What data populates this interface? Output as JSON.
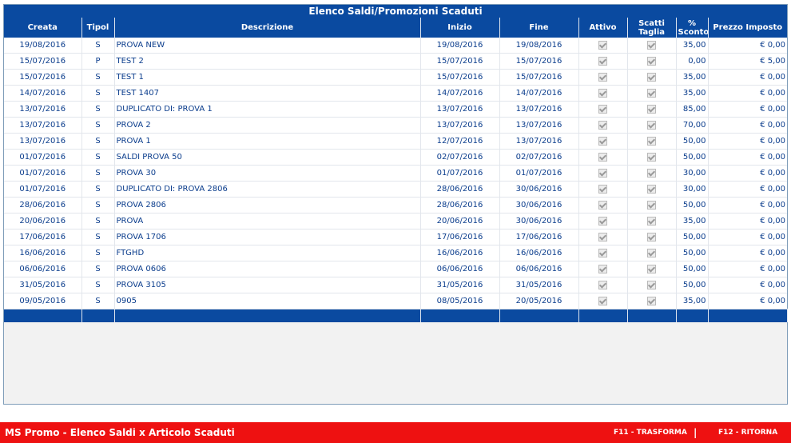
{
  "panel": {
    "title": "Elenco Saldi/Promozioni Scaduti"
  },
  "table": {
    "headers": [
      "Creata",
      "Tipol",
      "Descrizione",
      "Inizio",
      "Fine",
      "Attivo",
      "Scatti Taglia",
      "% Sconto",
      "Prezzo Imposto"
    ],
    "rows": [
      {
        "creata": "19/08/2016",
        "tipol": "S",
        "descrizione": "PROVA NEW",
        "inizio": "19/08/2016",
        "fine": "19/08/2016",
        "attivo": true,
        "scatti": true,
        "sconto": "35,00",
        "prezzo": "€ 0,00"
      },
      {
        "creata": "15/07/2016",
        "tipol": "P",
        "descrizione": "TEST 2",
        "inizio": "15/07/2016",
        "fine": "15/07/2016",
        "attivo": true,
        "scatti": true,
        "sconto": "0,00",
        "prezzo": "€ 5,00"
      },
      {
        "creata": "15/07/2016",
        "tipol": "S",
        "descrizione": "TEST 1",
        "inizio": "15/07/2016",
        "fine": "15/07/2016",
        "attivo": true,
        "scatti": true,
        "sconto": "35,00",
        "prezzo": "€ 0,00"
      },
      {
        "creata": "14/07/2016",
        "tipol": "S",
        "descrizione": "TEST 1407",
        "inizio": "14/07/2016",
        "fine": "14/07/2016",
        "attivo": true,
        "scatti": true,
        "sconto": "35,00",
        "prezzo": "€ 0,00"
      },
      {
        "creata": "13/07/2016",
        "tipol": "S",
        "descrizione": "DUPLICATO DI: PROVA 1",
        "inizio": "13/07/2016",
        "fine": "13/07/2016",
        "attivo": true,
        "scatti": true,
        "sconto": "85,00",
        "prezzo": "€ 0,00"
      },
      {
        "creata": "13/07/2016",
        "tipol": "S",
        "descrizione": "PROVA 2",
        "inizio": "13/07/2016",
        "fine": "13/07/2016",
        "attivo": true,
        "scatti": true,
        "sconto": "70,00",
        "prezzo": "€ 0,00"
      },
      {
        "creata": "13/07/2016",
        "tipol": "S",
        "descrizione": "PROVA 1",
        "inizio": "12/07/2016",
        "fine": "13/07/2016",
        "attivo": true,
        "scatti": true,
        "sconto": "50,00",
        "prezzo": "€ 0,00"
      },
      {
        "creata": "01/07/2016",
        "tipol": "S",
        "descrizione": "SALDI PROVA 50",
        "inizio": "02/07/2016",
        "fine": "02/07/2016",
        "attivo": true,
        "scatti": true,
        "sconto": "50,00",
        "prezzo": "€ 0,00"
      },
      {
        "creata": "01/07/2016",
        "tipol": "S",
        "descrizione": "PROVA 30",
        "inizio": "01/07/2016",
        "fine": "01/07/2016",
        "attivo": true,
        "scatti": true,
        "sconto": "30,00",
        "prezzo": "€ 0,00"
      },
      {
        "creata": "01/07/2016",
        "tipol": "S",
        "descrizione": "DUPLICATO DI: PROVA 2806",
        "inizio": "28/06/2016",
        "fine": "30/06/2016",
        "attivo": true,
        "scatti": true,
        "sconto": "30,00",
        "prezzo": "€ 0,00"
      },
      {
        "creata": "28/06/2016",
        "tipol": "S",
        "descrizione": "PROVA 2806",
        "inizio": "28/06/2016",
        "fine": "30/06/2016",
        "attivo": true,
        "scatti": true,
        "sconto": "50,00",
        "prezzo": "€ 0,00"
      },
      {
        "creata": "20/06/2016",
        "tipol": "S",
        "descrizione": "PROVA",
        "inizio": "20/06/2016",
        "fine": "30/06/2016",
        "attivo": true,
        "scatti": true,
        "sconto": "35,00",
        "prezzo": "€ 0,00"
      },
      {
        "creata": "17/06/2016",
        "tipol": "S",
        "descrizione": "PROVA 1706",
        "inizio": "17/06/2016",
        "fine": "17/06/2016",
        "attivo": true,
        "scatti": true,
        "sconto": "50,00",
        "prezzo": "€ 0,00"
      },
      {
        "creata": "16/06/2016",
        "tipol": "S",
        "descrizione": "FTGHD",
        "inizio": "16/06/2016",
        "fine": "16/06/2016",
        "attivo": true,
        "scatti": true,
        "sconto": "50,00",
        "prezzo": "€ 0,00"
      },
      {
        "creata": "06/06/2016",
        "tipol": "S",
        "descrizione": "PROVA 0606",
        "inizio": "06/06/2016",
        "fine": "06/06/2016",
        "attivo": true,
        "scatti": true,
        "sconto": "50,00",
        "prezzo": "€ 0,00"
      },
      {
        "creata": "31/05/2016",
        "tipol": "S",
        "descrizione": "PROVA 3105",
        "inizio": "31/05/2016",
        "fine": "31/05/2016",
        "attivo": true,
        "scatti": true,
        "sconto": "50,00",
        "prezzo": "€ 0,00"
      },
      {
        "creata": "09/05/2016",
        "tipol": "S",
        "descrizione": "0905",
        "inizio": "08/05/2016",
        "fine": "20/05/2016",
        "attivo": true,
        "scatti": true,
        "sconto": "35,00",
        "prezzo": "€ 0,00"
      }
    ]
  },
  "statusbar": {
    "app_title": "MS Promo - Elenco Saldi x Articolo Scaduti",
    "f11_label": "F11 - TRASFORMA",
    "separator": "|",
    "f12_label": "F12 - RITORNA"
  },
  "colors": {
    "header_blue": "#0a4aa0",
    "status_red": "#ee1111",
    "cell_text": "#0a3c8c"
  }
}
